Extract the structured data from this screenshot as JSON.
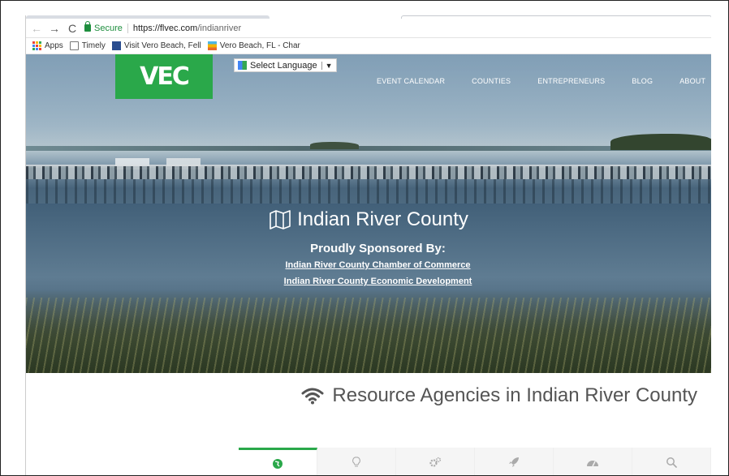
{
  "browser": {
    "address": {
      "secure_label": "Secure",
      "url_host": "https://flvec.com",
      "url_path": "/indianriver"
    },
    "bookmarks": [
      {
        "label": "Apps",
        "icon": "apps-grid-icon"
      },
      {
        "label": "Timely",
        "icon": "document-icon"
      },
      {
        "label": "Visit Vero Beach, Fell",
        "icon": "calendar-icon"
      },
      {
        "label": "Vero Beach, FL - Char",
        "icon": "weather-icon"
      }
    ]
  },
  "site": {
    "logo_text": "VEC",
    "language_selector": "Select Language",
    "language_arrow": "▼",
    "nav": [
      "EVENT CALENDAR",
      "COUNTIES",
      "ENTREPRENEURS",
      "BLOG",
      "ABOUT"
    ]
  },
  "hero": {
    "title": "Indian River County",
    "sponsor_heading": "Proudly Sponsored By:",
    "sponsors": [
      "Indian River County Chamber of Commerce",
      "Indian River County Economic Development"
    ]
  },
  "resources": {
    "title": "Resource Agencies in Indian River County",
    "tabs": [
      {
        "icon": "globe-icon",
        "active": true
      },
      {
        "icon": "lightbulb-icon",
        "active": false
      },
      {
        "icon": "gears-icon",
        "active": false
      },
      {
        "icon": "rocket-icon",
        "active": false
      },
      {
        "icon": "dashboard-icon",
        "active": false
      },
      {
        "icon": "search-icon",
        "active": false
      }
    ]
  },
  "colors": {
    "brand_green": "#2aa84a",
    "secure_green": "#1e8e3e"
  }
}
